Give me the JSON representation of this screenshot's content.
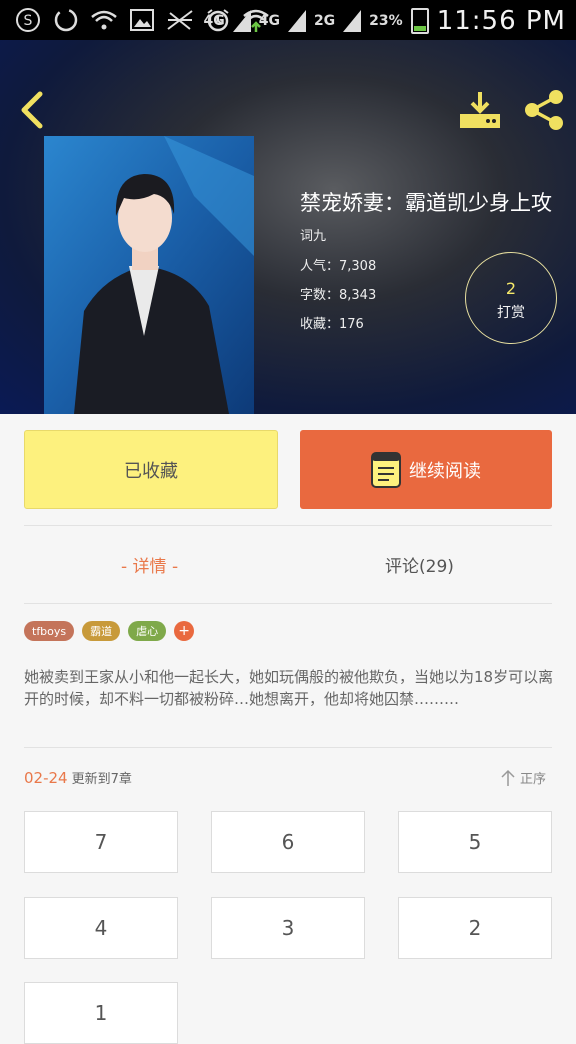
{
  "status_bar": {
    "network_1": "4G",
    "network_2": "4G",
    "network_3": "2G",
    "battery": "23%",
    "time": "11:56 PM",
    "battery_level": 0.23,
    "battery_color": "#6cc644"
  },
  "book": {
    "title": "禁宠娇妻：霸道凯少身上攻",
    "author": "词九",
    "popularity": "人气：7,308",
    "word_count": "字数：8,343",
    "favorites": "收藏：176",
    "reward_count": "2",
    "reward_label": "打赏"
  },
  "actions": {
    "favorited_label": "已收藏",
    "continue_label": "继续阅读"
  },
  "tabs": {
    "detail": "- 详情 -",
    "comments": "评论(29)"
  },
  "tags": [
    {
      "label": "tfboys",
      "color": "#c4745a"
    },
    {
      "label": "霸道",
      "color": "#c89a3a"
    },
    {
      "label": "虐心",
      "color": "#7fa94a"
    }
  ],
  "tag_add": "+",
  "description": "她被卖到王家从小和他一起长大，她如玩偶般的被他欺负，当她以为18岁可以离开的时候，却不料一切都被粉碎…她想离开，他却将她囚禁………",
  "update": {
    "date": "02-24",
    "text": "更新到7章"
  },
  "sort_label": "正序",
  "chapters": [
    "7",
    "6",
    "5",
    "4",
    "3",
    "2",
    "1"
  ],
  "colors": {
    "accent": "#e9693f",
    "favorite_bg": "#fdf17e"
  }
}
